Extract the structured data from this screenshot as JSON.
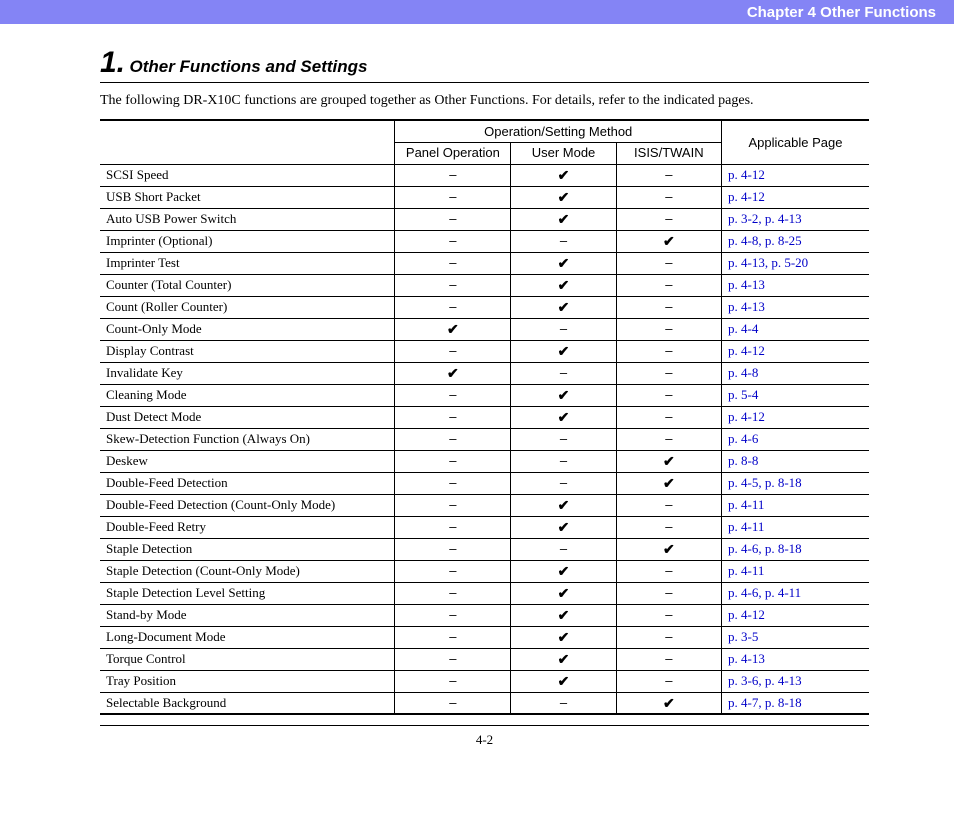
{
  "header": {
    "chapter": "Chapter 4   Other Functions"
  },
  "section": {
    "number": "1.",
    "title": "Other Functions and Settings",
    "intro": "The following DR-X10C functions are grouped together as Other Functions. For details, refer to the indicated pages."
  },
  "table": {
    "head": {
      "group": "Operation/Setting Method",
      "col1": "Panel Operation",
      "col2": "User Mode",
      "col3": "ISIS/TWAIN",
      "col4": "Applicable Page"
    },
    "dash": "–",
    "check": "✔",
    "rows": [
      {
        "name": "SCSI Speed",
        "panel": "–",
        "user": "✔",
        "isis": "–",
        "pages": "p. 4-12"
      },
      {
        "name": "USB Short Packet",
        "panel": "–",
        "user": "✔",
        "isis": "–",
        "pages": "p. 4-12"
      },
      {
        "name": "Auto USB Power Switch",
        "panel": "–",
        "user": "✔",
        "isis": "–",
        "pages": "p. 3-2,  p. 4-13"
      },
      {
        "name": "Imprinter (Optional)",
        "panel": "–",
        "user": "–",
        "isis": "✔",
        "pages": "p. 4-8,  p. 8-25"
      },
      {
        "name": "Imprinter Test",
        "panel": "–",
        "user": "✔",
        "isis": "–",
        "pages": "p. 4-13,  p. 5-20"
      },
      {
        "name": "Counter (Total Counter)",
        "panel": "–",
        "user": "✔",
        "isis": "–",
        "pages": "p. 4-13"
      },
      {
        "name": "Count (Roller Counter)",
        "panel": "–",
        "user": "✔",
        "isis": "–",
        "pages": "p. 4-13"
      },
      {
        "name": "Count-Only Mode",
        "panel": "✔",
        "user": "–",
        "isis": "–",
        "pages": "p. 4-4"
      },
      {
        "name": "Display Contrast",
        "panel": "–",
        "user": "✔",
        "isis": "–",
        "pages": "p. 4-12"
      },
      {
        "name": "Invalidate Key",
        "panel": "✔",
        "user": "–",
        "isis": "–",
        "pages": "p. 4-8"
      },
      {
        "name": "Cleaning Mode",
        "panel": "–",
        "user": "✔",
        "isis": "–",
        "pages": "p. 5-4"
      },
      {
        "name": "Dust Detect Mode",
        "panel": "–",
        "user": "✔",
        "isis": "–",
        "pages": "p. 4-12"
      },
      {
        "name": "Skew-Detection Function (Always On)",
        "panel": "–",
        "user": "–",
        "isis": "–",
        "pages": "p. 4-6"
      },
      {
        "name": "Deskew",
        "panel": "–",
        "user": "–",
        "isis": "✔",
        "pages": "p. 8-8"
      },
      {
        "name": "Double-Feed Detection",
        "panel": "–",
        "user": "–",
        "isis": "✔",
        "pages": "p. 4-5,  p. 8-18"
      },
      {
        "name": "Double-Feed Detection (Count-Only Mode)",
        "panel": "–",
        "user": "✔",
        "isis": "–",
        "pages": "p. 4-11"
      },
      {
        "name": "Double-Feed Retry",
        "panel": "–",
        "user": "✔",
        "isis": "–",
        "pages": "p. 4-11"
      },
      {
        "name": "Staple Detection",
        "panel": "–",
        "user": "–",
        "isis": "✔",
        "pages": "p. 4-6,  p. 8-18"
      },
      {
        "name": "Staple Detection (Count-Only Mode)",
        "panel": "–",
        "user": "✔",
        "isis": "–",
        "pages": "p. 4-11"
      },
      {
        "name": "Staple Detection Level Setting",
        "panel": "–",
        "user": "✔",
        "isis": "–",
        "pages": "p. 4-6,  p. 4-11"
      },
      {
        "name": "Stand-by Mode",
        "panel": "–",
        "user": "✔",
        "isis": "–",
        "pages": "p. 4-12"
      },
      {
        "name": "Long-Document Mode",
        "panel": "–",
        "user": "✔",
        "isis": "–",
        "pages": "p. 3-5"
      },
      {
        "name": "Torque Control",
        "panel": "–",
        "user": "✔",
        "isis": "–",
        "pages": "p. 4-13"
      },
      {
        "name": "Tray Position",
        "panel": "–",
        "user": "✔",
        "isis": "–",
        "pages": "p. 3-6,  p. 4-13"
      },
      {
        "name": "Selectable Background",
        "panel": "–",
        "user": "–",
        "isis": "✔",
        "pages": "p. 4-7,  p. 8-18"
      }
    ]
  },
  "footer": {
    "page": "4-2"
  }
}
